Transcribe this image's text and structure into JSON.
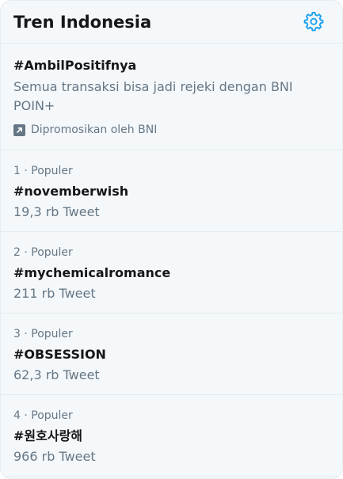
{
  "header": {
    "title": "Tren Indonesia",
    "settings_icon": "gear-icon",
    "accent_color": "#1da1f2"
  },
  "promoted": {
    "hashtag": "#AmbilPositifnya",
    "description": "Semua transaksi bisa jadi rejeki dengan BNI POIN+",
    "promoted_by": "Dipromosikan oleh BNI",
    "icon": "promoted-arrow-icon"
  },
  "trends": [
    {
      "meta": "1 · Populer",
      "name": "#novemberwish",
      "count": "19,3 rb Tweet"
    },
    {
      "meta": "2 · Populer",
      "name": "#mychemicalromance",
      "count": "211 rb Tweet"
    },
    {
      "meta": "3 · Populer",
      "name": "#OBSESSION",
      "count": "62,3 rb Tweet"
    },
    {
      "meta": "4 · Populer",
      "name": "#원호사랑해",
      "count": "966 rb Tweet"
    }
  ]
}
